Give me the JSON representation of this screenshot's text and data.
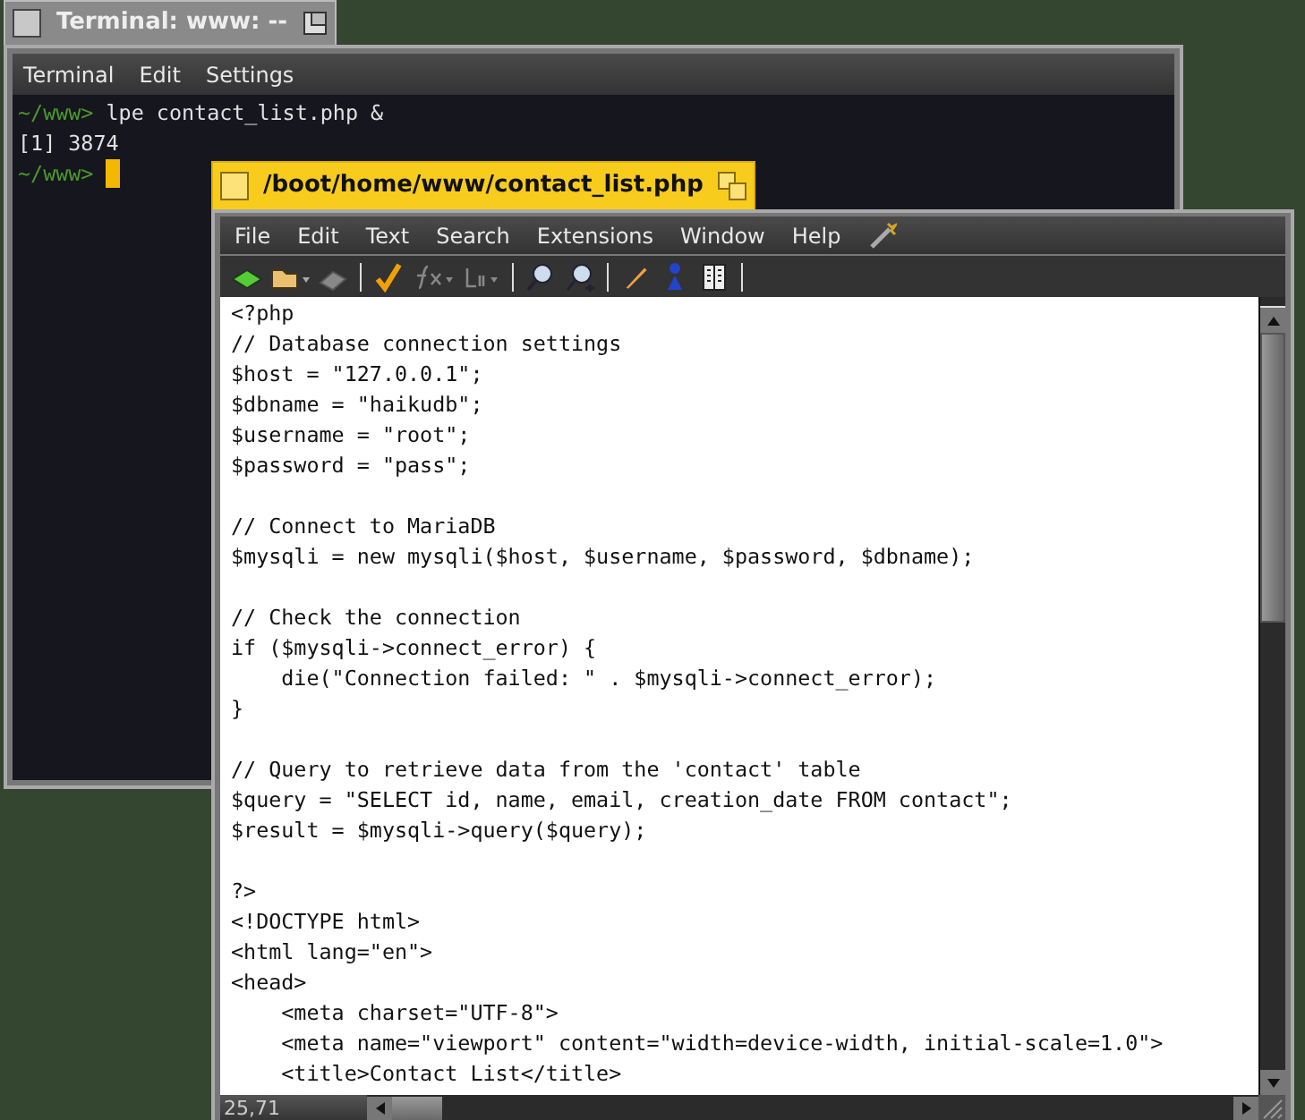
{
  "terminal": {
    "title": "Terminal: www: --",
    "menu": [
      "Terminal",
      "Edit",
      "Settings"
    ],
    "lines": [
      {
        "prompt": "~/www>",
        "text": "lpe contact_list.php &",
        "cursor": false
      },
      {
        "text": "[1] 3874",
        "cursor": false
      },
      {
        "prompt": "~/www>",
        "cursor": true
      }
    ]
  },
  "editor": {
    "title": "/boot/home/www/contact_list.php",
    "menu": [
      "File",
      "Edit",
      "Text",
      "Search",
      "Extensions",
      "Window",
      "Help"
    ],
    "code_blocks": [
      [
        "<?php",
        "// Database connection settings",
        "$host = \"127.0.0.1\";",
        "$dbname = \"haikudb\";",
        "$username = \"root\";",
        "$password = \"pass\";"
      ],
      [
        "// Connect to MariaDB",
        "$mysqli = new mysqli($host, $username, $password, $dbname);"
      ],
      [
        "// Check the connection",
        "if ($mysqli->connect_error) {",
        "    die(\"Connection failed: \" . $mysqli->connect_error);",
        "}"
      ],
      [
        "// Query to retrieve data from the 'contact' table",
        "$query = \"SELECT id, name, email, creation_date FROM contact\";",
        "$result = $mysqli->query($query);"
      ],
      [
        "?>",
        "<!DOCTYPE html>",
        "<html lang=\"en\">",
        "<head>",
        "    <meta charset=\"UTF-8\">",
        "    <meta name=\"viewport\" content=\"width=device-width, initial-scale=1.0\">",
        "    <title>Contact List</title>"
      ]
    ],
    "status": "25,71"
  }
}
